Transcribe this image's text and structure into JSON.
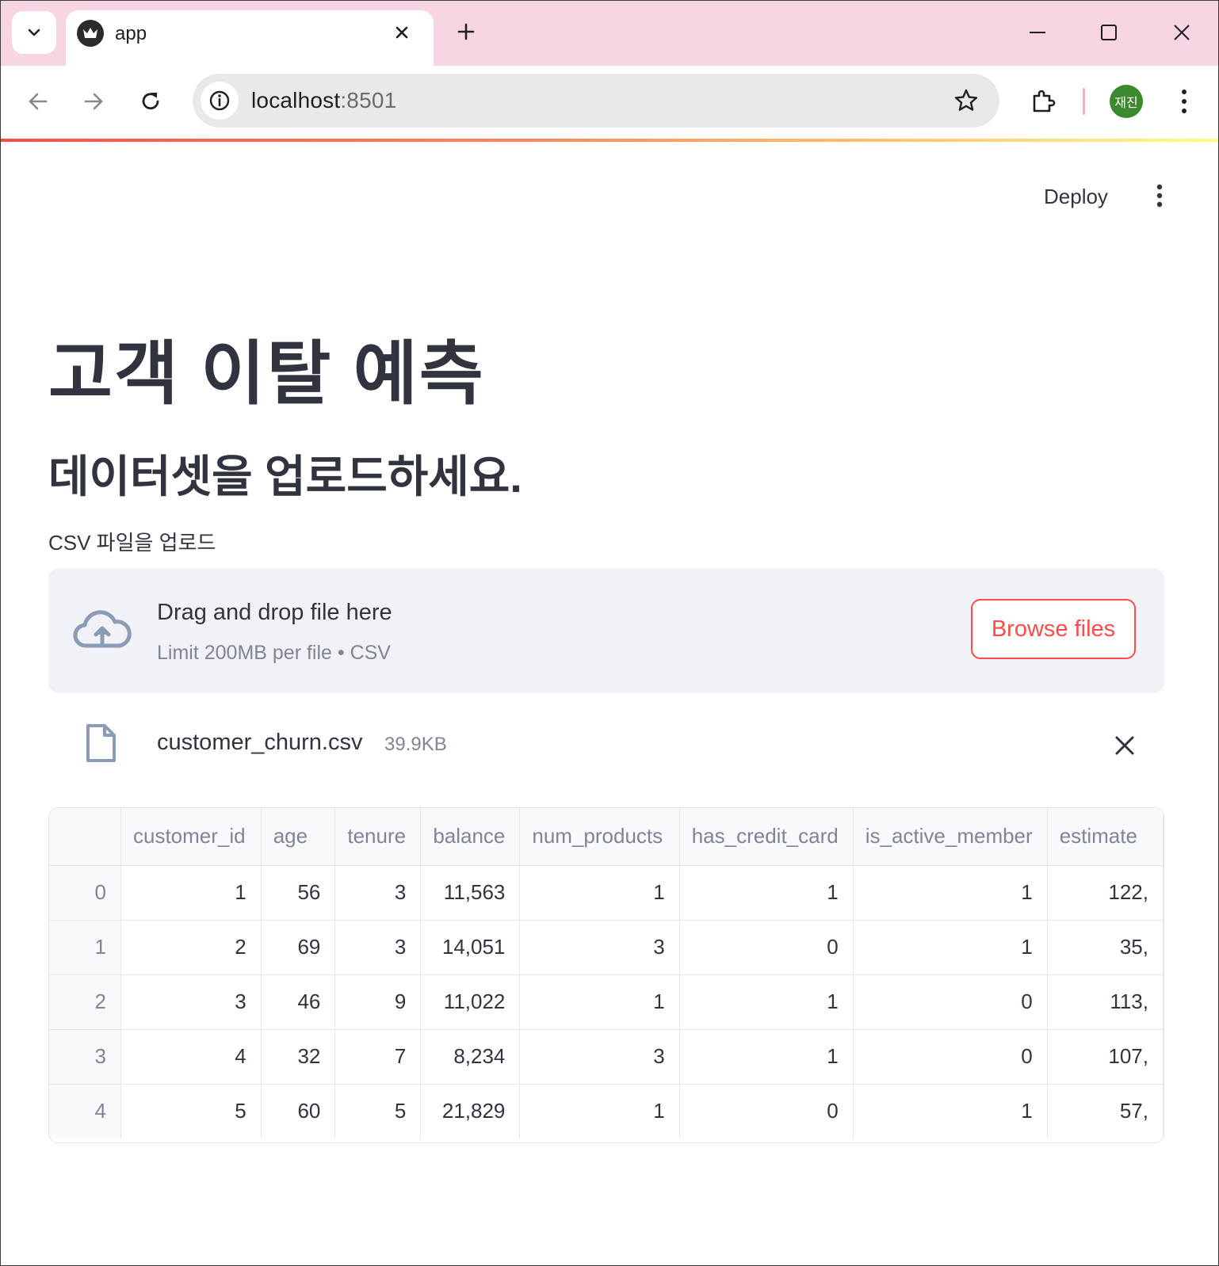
{
  "browser": {
    "tab_title": "app",
    "url_host": "localhost",
    "url_port": ":8501",
    "profile_initials": "재진"
  },
  "header": {
    "deploy_label": "Deploy"
  },
  "main": {
    "title": "고객 이탈 예측",
    "subtitle": "데이터셋을 업로드하세요.",
    "uploader": {
      "label": "CSV 파일을 업로드",
      "drop_text": "Drag and drop file here",
      "limit_text": "Limit 200MB per file • CSV",
      "browse_label": "Browse files"
    },
    "file": {
      "name": "customer_churn.csv",
      "size": "39.9KB"
    },
    "table": {
      "columns": [
        "",
        "customer_id",
        "age",
        "tenure",
        "balance",
        "num_products",
        "has_credit_card",
        "is_active_member",
        "estimate"
      ],
      "rows": [
        [
          "0",
          "1",
          "56",
          "3",
          "11,563",
          "1",
          "1",
          "1",
          "122,"
        ],
        [
          "1",
          "2",
          "69",
          "3",
          "14,051",
          "3",
          "0",
          "1",
          "35,"
        ],
        [
          "2",
          "3",
          "46",
          "9",
          "11,022",
          "1",
          "1",
          "0",
          "113,"
        ],
        [
          "3",
          "4",
          "32",
          "7",
          "8,234",
          "3",
          "1",
          "0",
          "107,"
        ],
        [
          "4",
          "5",
          "60",
          "5",
          "21,829",
          "1",
          "0",
          "1",
          "57,"
        ]
      ]
    }
  },
  "colors": {
    "tab_strip": "#f7d5e3",
    "accent_red": "#ff4b4b",
    "text_primary": "#31333f",
    "text_muted": "#808495",
    "dropzone_bg": "#f0f2f6"
  }
}
